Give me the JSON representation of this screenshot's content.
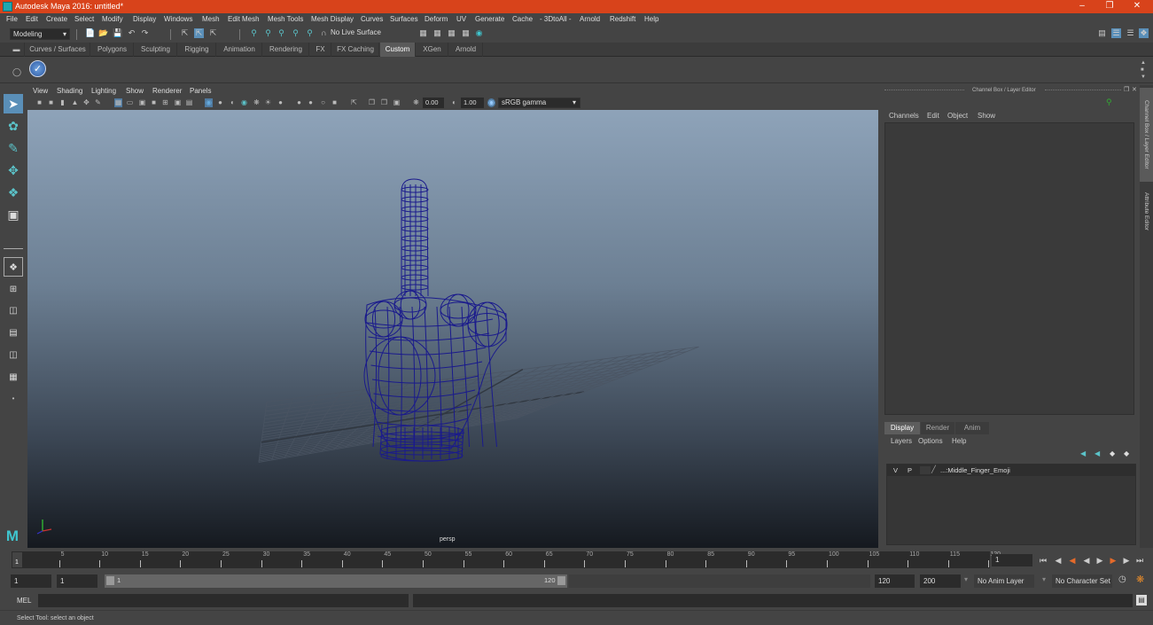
{
  "window": {
    "title": "Autodesk Maya 2016: untitled*",
    "controls": [
      "minimize",
      "restore",
      "close"
    ],
    "accent_color": "#d8431b"
  },
  "menubar": {
    "items": [
      "File",
      "Edit",
      "Create",
      "Select",
      "Modify",
      "Display",
      "Windows",
      "Mesh",
      "Edit Mesh",
      "Mesh Tools",
      "Mesh Display",
      "Curves",
      "Surfaces",
      "Deform",
      "UV",
      "Generate",
      "Cache",
      "- 3DtoAll -",
      "Arnold",
      "Redshift",
      "Help"
    ]
  },
  "status_line": {
    "menu_set": "Modeling",
    "live_surface": "No Live Surface"
  },
  "shelf": {
    "tabs": [
      "Curves / Surfaces",
      "Polygons",
      "Sculpting",
      "Rigging",
      "Animation",
      "Rendering",
      "FX",
      "FX Caching",
      "Custom",
      "XGen",
      "Arnold"
    ],
    "active_tab": "Custom"
  },
  "viewport": {
    "menu": [
      "View",
      "Shading",
      "Lighting",
      "Show",
      "Renderer",
      "Panels"
    ],
    "exposure": "0.00",
    "gamma": "1.00",
    "color_space": "sRGB gamma",
    "camera_label": "persp",
    "object": "Middle_Finger_Emoji wireframe",
    "wire_color": "#1a1a8c"
  },
  "channel_box": {
    "title": "Channel Box / Layer Editor",
    "menu": [
      "Channels",
      "Edit",
      "Object",
      "Show"
    ]
  },
  "layer_editor": {
    "tabs": [
      "Display",
      "Render",
      "Anim"
    ],
    "active_tab": "Display",
    "menu": [
      "Layers",
      "Options",
      "Help"
    ],
    "layers": [
      {
        "visible": "V",
        "playback": "P",
        "name": "...:Middle_Finger_Emoji"
      }
    ]
  },
  "side_tabs": [
    "Channel Box / Layer Editor",
    "Attribute Editor"
  ],
  "timeline": {
    "ticks": [
      "5",
      "10",
      "15",
      "20",
      "25",
      "30",
      "35",
      "40",
      "45",
      "50",
      "55",
      "60",
      "65",
      "70",
      "75",
      "80",
      "85",
      "90",
      "95",
      "100",
      "105",
      "110",
      "115",
      "120"
    ],
    "current_frame_marker": "1",
    "current_frame": "1"
  },
  "range": {
    "start": "1",
    "playback_start": "1",
    "slider_start": "1",
    "slider_end": "120",
    "playback_end": "120",
    "end": "200",
    "anim_layer": "No Anim Layer",
    "character_set": "No Character Set"
  },
  "command_line": {
    "label": "MEL",
    "value": ""
  },
  "help_line": {
    "text": "Select Tool: select an object"
  }
}
